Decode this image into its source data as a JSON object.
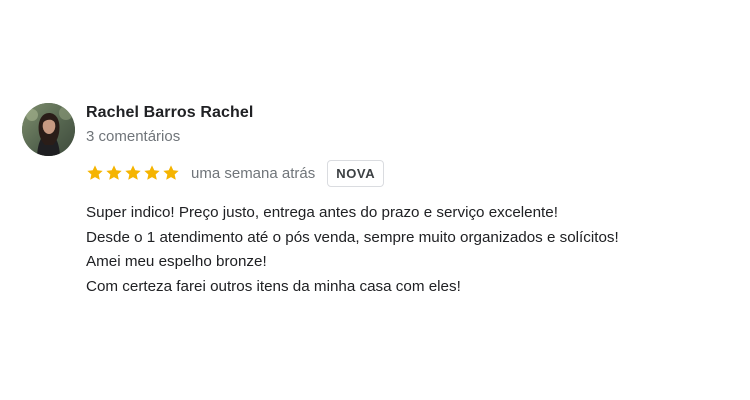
{
  "review": {
    "author": {
      "name": "Rachel Barros Rachel",
      "meta": "3 comentários",
      "avatar_icon": "user-photo-avatar"
    },
    "rating": {
      "stars": 5,
      "max_stars": 5,
      "star_color": "#f5b400",
      "star_icon": "star-icon"
    },
    "time": "uma semana atrás",
    "badge": "NOVA",
    "text_lines": [
      "Super indico! Preço justo, entrega antes do prazo e serviço excelente!",
      "Desde o 1 atendimento até o pós venda, sempre muito organizados e solícitos!",
      "Amei meu espelho bronze!",
      "Com certeza farei outros itens da minha casa com eles!"
    ]
  },
  "colors": {
    "text_primary": "#202124",
    "text_secondary": "#70757a",
    "badge_border": "#dadce0",
    "background": "#ffffff"
  }
}
